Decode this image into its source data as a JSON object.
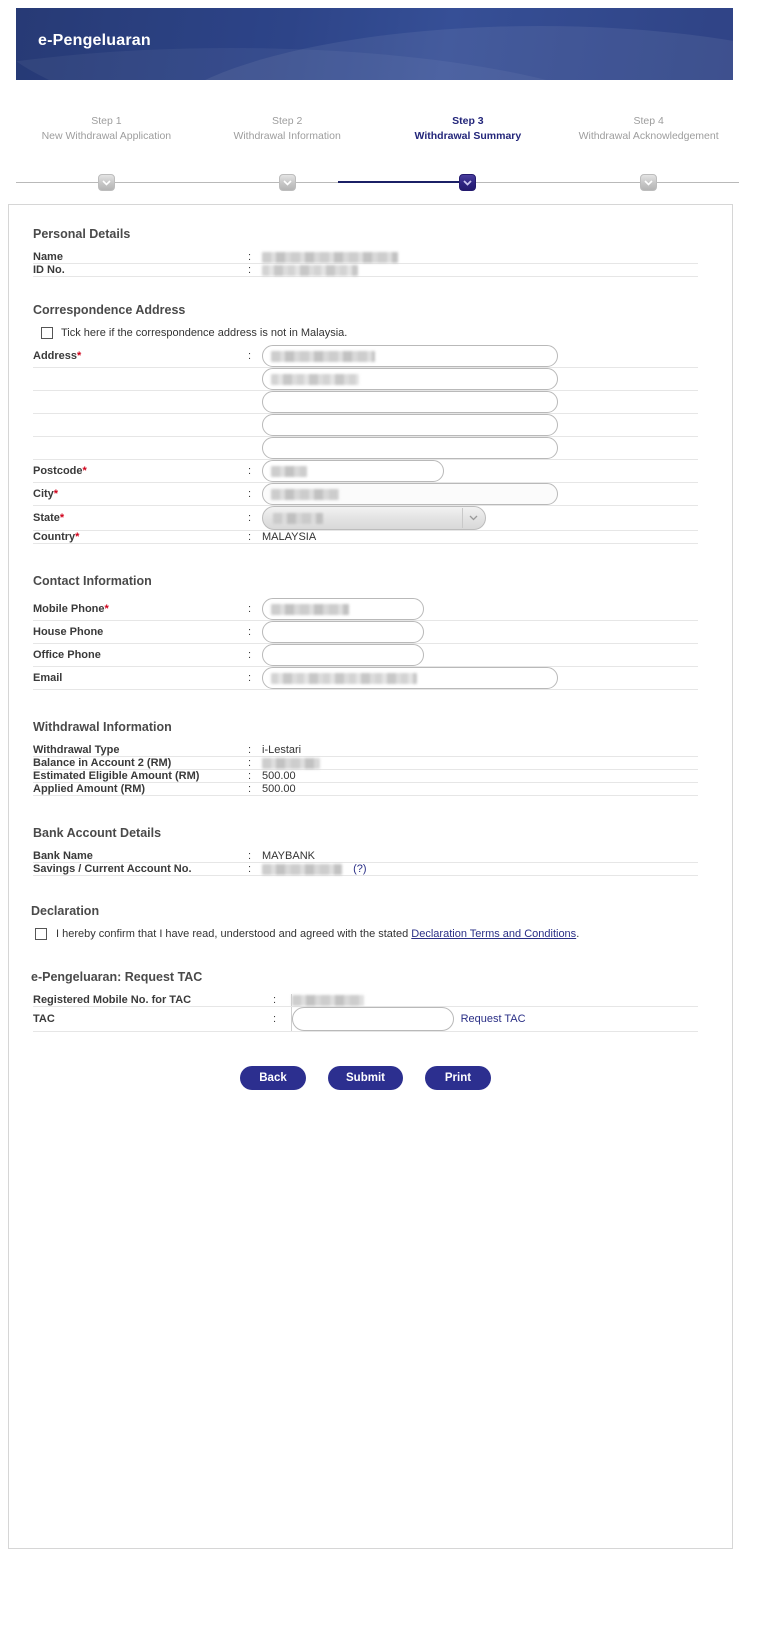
{
  "banner": {
    "title": "e-Pengeluaran"
  },
  "stepper": {
    "steps": [
      {
        "num": "Step 1",
        "name": "New Withdrawal Application",
        "active": false
      },
      {
        "num": "Step 2",
        "name": "Withdrawal Information",
        "active": false
      },
      {
        "num": "Step 3",
        "name": "Withdrawal Summary",
        "active": true
      },
      {
        "num": "Step 4",
        "name": "Withdrawal Acknowledgement",
        "active": false
      }
    ],
    "active_color": "#23267a",
    "inactive_color": "#9d9d9d"
  },
  "personal_details": {
    "title": "Personal Details",
    "rows": [
      {
        "label": "Name",
        "colon": ":",
        "value": ""
      },
      {
        "label": "ID No.",
        "colon": ":",
        "value": ""
      }
    ]
  },
  "correspondence_address": {
    "title": "Correspondence Address",
    "not_in_malaysia_label": "Tick here if the correspondence address is not in Malaysia.",
    "not_in_malaysia_checked": false,
    "address_label": "Address",
    "address_required": "*",
    "address_lines": [
      "",
      "",
      "",
      "",
      ""
    ],
    "postcode_label": "Postcode",
    "postcode_required": "*",
    "postcode_value": "",
    "city_label": "City",
    "city_required": "*",
    "city_value": "",
    "state_label": "State",
    "state_required": "*",
    "state_value": "",
    "country_label": "Country",
    "country_required": "*",
    "country_value": "MALAYSIA",
    "colon": ":"
  },
  "contact_information": {
    "title": "Contact Information",
    "rows": [
      {
        "label": "Mobile Phone",
        "required": "*",
        "colon": ":",
        "value": "",
        "redacted": true
      },
      {
        "label": "House Phone",
        "required": "",
        "colon": ":",
        "value": "",
        "redacted": false
      },
      {
        "label": "Office Phone",
        "required": "",
        "colon": ":",
        "value": "",
        "redacted": false
      },
      {
        "label": "Email",
        "required": "",
        "colon": ":",
        "value": "",
        "redacted": true
      }
    ]
  },
  "withdrawal_information": {
    "title": "Withdrawal Information",
    "rows": [
      {
        "label": "Withdrawal Type",
        "colon": ":",
        "value": "i-Lestari",
        "redacted": false
      },
      {
        "label": "Balance in Account 2 (RM)",
        "colon": ":",
        "value": "",
        "redacted": true
      },
      {
        "label": "Estimated Eligible Amount (RM)",
        "colon": ":",
        "value": "500.00",
        "redacted": false
      },
      {
        "label": "Applied Amount (RM)",
        "colon": ":",
        "value": "500.00",
        "redacted": false
      }
    ]
  },
  "bank_account_details": {
    "title": "Bank Account Details",
    "rows": [
      {
        "label": "Bank Name",
        "colon": ":",
        "value": "MAYBANK",
        "redacted": false
      },
      {
        "label": "Savings / Current Account No.",
        "colon": ":",
        "value": "",
        "suffix": "(?)",
        "redacted": true
      }
    ]
  },
  "declaration": {
    "title": "Declaration",
    "checked": false,
    "text_before": "I hereby confirm that I have read, understood and agreed with the stated",
    "link_text": "Declaration Terms and Conditions",
    "text_after": "."
  },
  "request_tac": {
    "title": "e-Pengeluaran: Request TAC",
    "mobile_label": "Registered Mobile No. for TAC",
    "mobile_colon": ":",
    "mobile_value": "",
    "tac_label": "TAC",
    "tac_colon": ":",
    "tac_value": "",
    "request_link": "Request TAC"
  },
  "buttons": {
    "back": "Back",
    "submit": "Submit",
    "print": "Print",
    "color": "#2c2f8f"
  }
}
